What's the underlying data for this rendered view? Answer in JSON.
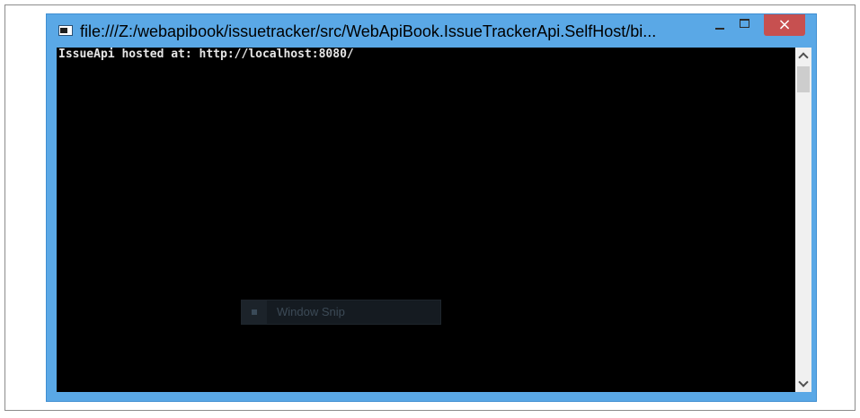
{
  "window": {
    "title": "file:///Z:/webapibook/issuetracker/src/WebApiBook.IssueTrackerApi.SelfHost/bi...",
    "close_glyph": "×"
  },
  "console": {
    "lines": [
      "IssueApi hosted at: http://localhost:8080/"
    ]
  },
  "overlay": {
    "label": "Window Snip"
  },
  "icons": {
    "app": "console-window-icon",
    "minimize": "minimize-icon",
    "maximize": "maximize-icon",
    "close": "close-icon",
    "scroll_up": "chevron-up-icon",
    "scroll_down": "chevron-down-icon"
  },
  "colors": {
    "titlebar": "#5aa8e6",
    "close_button": "#c75050",
    "console_bg": "#000000",
    "console_text": "#e6e6e6"
  }
}
